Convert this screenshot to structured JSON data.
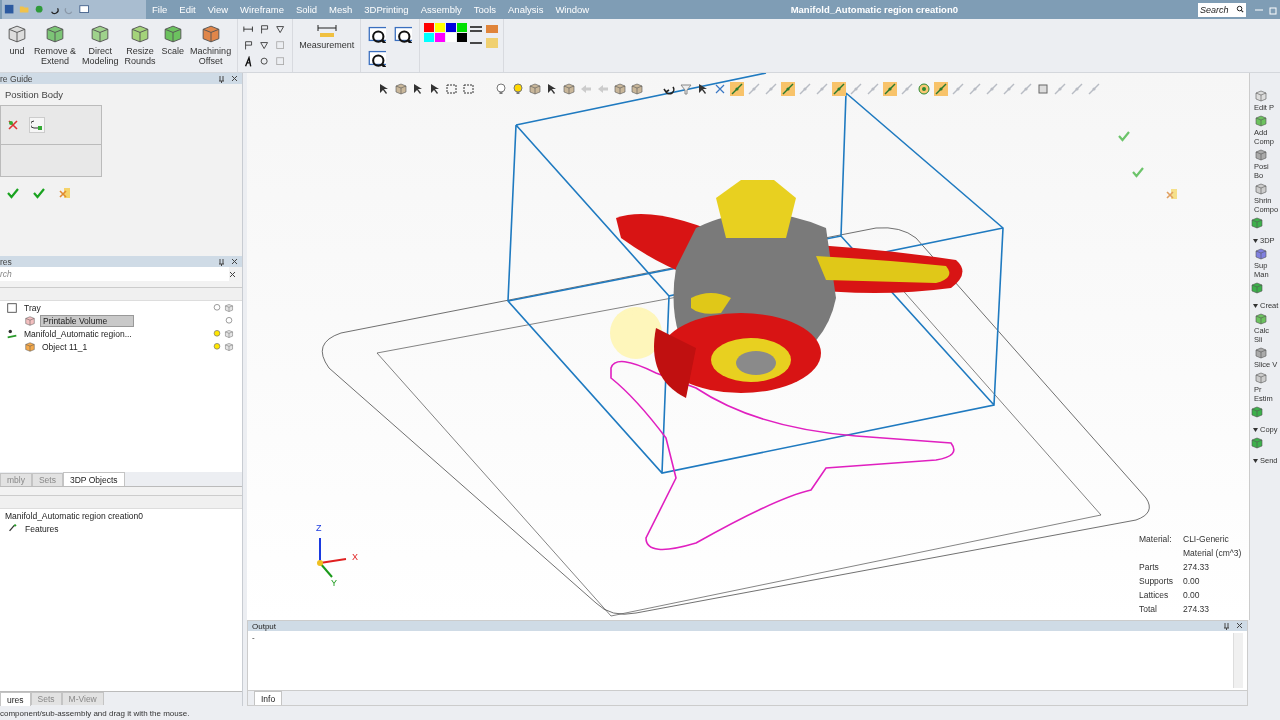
{
  "title_bar": {
    "title": "Manifold_Automatic region creation0",
    "search": {
      "placeholder": "Search"
    }
  },
  "menu": [
    "File",
    "Edit",
    "View",
    "Wireframe",
    "Solid",
    "Mesh",
    "3DPrinting",
    "Assembly",
    "Tools",
    "Analysis",
    "Window"
  ],
  "ribbon_buttons": [
    {
      "lines": [
        "und"
      ]
    },
    {
      "lines": [
        "Remove &",
        "Extend"
      ]
    },
    {
      "lines": [
        "Direct",
        "Modeling"
      ]
    },
    {
      "lines": [
        "Resize",
        "Rounds"
      ]
    },
    {
      "lines": [
        "Scale"
      ]
    },
    {
      "lines": [
        "Machining",
        "Offset"
      ]
    }
  ],
  "measure_button": {
    "lines": [
      "Measurement"
    ]
  },
  "palette": [
    {
      "color": "#ff0000"
    },
    {
      "color": "#ffff00"
    },
    {
      "color": "#0000e0"
    },
    {
      "color": "#00e000"
    },
    {
      "color": "#00ffff"
    },
    {
      "color": "#ff00ff"
    },
    {
      "color": "#ffffff"
    },
    {
      "color": "#000000"
    }
  ],
  "guide_panel": {
    "title": "re Guide",
    "step": "Position Body"
  },
  "features_panel": {
    "title": "res",
    "search": {
      "placeholder": "rch"
    },
    "tree": [
      {
        "label": "Tray",
        "selected": false,
        "children": [
          {
            "label": "Printable Volume",
            "selected": true
          }
        ]
      },
      {
        "label": "Manifold_Automatic region...",
        "selected": false,
        "children": [
          {
            "label": "Object 11_1",
            "selected": false
          }
        ]
      }
    ]
  },
  "left_tabs": [
    {
      "label": "mbly",
      "selected": false
    },
    {
      "label": "Sets",
      "selected": false
    },
    {
      "label": "3DP Objects",
      "selected": true
    }
  ],
  "object_panel": {
    "tree": [
      {
        "label": "Manifold_Automatic region creation0",
        "children": [
          {
            "label": "Features"
          }
        ]
      }
    ]
  },
  "bottom_tabs": [
    {
      "label": "ures",
      "selected": true
    },
    {
      "label": "Sets",
      "selected": false
    },
    {
      "label": "M-View",
      "selected": false
    }
  ],
  "viewport": {
    "axes": {
      "z": "Z",
      "x": "X",
      "y": "Y"
    },
    "info": [
      {
        "label": "Material:",
        "value": "CLI-Generic"
      },
      {
        "value": "Material (cm^3)"
      },
      {
        "label": "Parts",
        "value": "274.33"
      },
      {
        "label": "Supports",
        "value": "0.00"
      },
      {
        "label": "Lattices",
        "value": "0.00"
      },
      {
        "label": "Total",
        "value": "274.33"
      }
    ]
  },
  "right_toolbar": [
    {
      "kind": "button",
      "lines": [
        "Edit P"
      ]
    },
    {
      "kind": "button",
      "lines": [
        "Add",
        "Comp"
      ]
    },
    {
      "kind": "button",
      "lines": [
        "Posi",
        "Bo"
      ]
    },
    {
      "kind": "button",
      "lines": [
        "Shrin",
        "Compo"
      ]
    },
    {
      "kind": "icon"
    },
    {
      "kind": "section",
      "label": "3DP"
    },
    {
      "kind": "button",
      "lines": [
        "Sup",
        "Man"
      ]
    },
    {
      "kind": "icon"
    },
    {
      "kind": "section",
      "label": "Creat"
    },
    {
      "kind": "button",
      "lines": [
        "Calc",
        "Sli"
      ]
    },
    {
      "kind": "button",
      "lines": [
        "Slice V"
      ]
    },
    {
      "kind": "button",
      "lines": [
        "Pr",
        "Estim"
      ]
    },
    {
      "kind": "icon"
    },
    {
      "kind": "section",
      "label": "Copy"
    },
    {
      "kind": "icon"
    },
    {
      "kind": "section",
      "label": "Send"
    }
  ],
  "output": {
    "title": "Output",
    "lines": [
      "-"
    ],
    "tabs": [
      {
        "label": "Info",
        "selected": true
      }
    ]
  },
  "status_bar": {
    "text": "component/sub-assembly and drag it with the mouse."
  }
}
